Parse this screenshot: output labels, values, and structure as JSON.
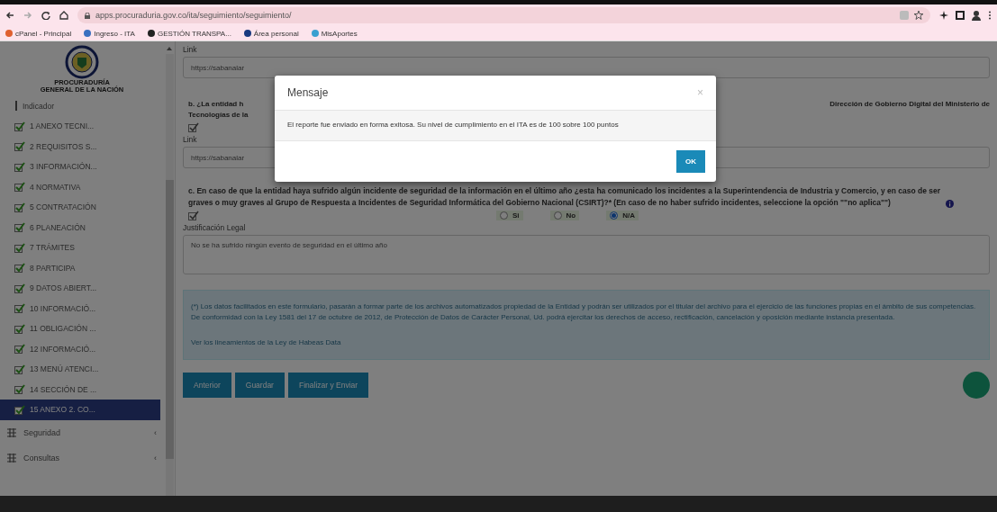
{
  "browser": {
    "url": "apps.procuraduria.gov.co/ita/seguimiento/seguimiento/",
    "bookmarks": [
      "cPanel - Principal",
      "Ingreso - ITA",
      "GESTIÓN TRANSPA...",
      "Área personal",
      "MisAportes"
    ]
  },
  "sidebar": {
    "logo_text": "PROCURADURÍA GENERAL DE LA NACIÓN",
    "items": [
      {
        "kind": "plain",
        "label": "Indicador",
        "selected": false
      },
      {
        "kind": "check",
        "label": "1 ANEXO TECNI...",
        "checked": true,
        "selected": false
      },
      {
        "kind": "check",
        "label": "2 REQUISITOS S...",
        "checked": true,
        "selected": false
      },
      {
        "kind": "check",
        "label": "3 INFORMACIÓN...",
        "checked": true,
        "selected": false
      },
      {
        "kind": "check",
        "label": "4 NORMATIVA",
        "checked": true,
        "selected": false
      },
      {
        "kind": "check",
        "label": "5 CONTRATACIÓN",
        "checked": true,
        "selected": false
      },
      {
        "kind": "check",
        "label": "6 PLANEACIÓN",
        "checked": true,
        "selected": false
      },
      {
        "kind": "check",
        "label": "7 TRÁMITES",
        "checked": true,
        "selected": false
      },
      {
        "kind": "check",
        "label": "8 PARTICIPA",
        "checked": true,
        "selected": false
      },
      {
        "kind": "check",
        "label": "9 DATOS ABIERT...",
        "checked": true,
        "selected": false
      },
      {
        "kind": "check",
        "label": "10 INFORMACIÓ...",
        "checked": true,
        "selected": false
      },
      {
        "kind": "check",
        "label": "11 OBLIGACIÓN ...",
        "checked": true,
        "selected": false
      },
      {
        "kind": "check",
        "label": "12 INFORMACIÓ...",
        "checked": true,
        "selected": false
      },
      {
        "kind": "check",
        "label": "13 MENÚ ATENCI...",
        "checked": true,
        "selected": false
      },
      {
        "kind": "check",
        "label": "14 SECCIÓN DE ...",
        "checked": true,
        "selected": false
      },
      {
        "kind": "check",
        "label": "15 ANEXO 2. CO...",
        "checked": true,
        "selected": true
      }
    ],
    "menus": [
      {
        "label": "Seguridad",
        "caret": "‹"
      },
      {
        "label": "Consultas",
        "caret": "‹"
      }
    ]
  },
  "form": {
    "link_1": {
      "label": "Link",
      "value": "https://sabanalar"
    },
    "question_b": {
      "start": "b. ¿La entidad h",
      "end": "Dirección de Gobierno Digital del Ministerio de",
      "line_2": "Tecnologías de la",
      "checked": true
    },
    "link_2": {
      "label": "Link",
      "value": "https://sabanalar"
    },
    "question_c": {
      "text": "c. En caso de que la entidad haya sufrido algún incidente de seguridad de la información en el último año ¿esta ha comunicado los incidentes a la Superintendencia de Industria y Comercio, y en caso de ser graves o muy graves al Grupo de Respuesta a Incidentes de Seguridad Informática del Gobierno Nacional (CSIRT)?* (En caso de no haber sufrido incidentes, seleccione la opción \"\"no aplica\"\")",
      "checked": true,
      "options": [
        {
          "label": "Si",
          "selected": false
        },
        {
          "label": "No",
          "selected": false
        },
        {
          "label": "N/A",
          "selected": true
        }
      ]
    },
    "justification": {
      "label": "Justificación Legal",
      "value": "No se ha sufrido ningún evento de seguridad en el último año"
    },
    "notice": {
      "text": "(*) Los datos facilitados en este formulario, pasarán a formar parte de los archivos automatizados propiedad de la Entidad y podrán ser utilizados por el titular del archivo para el ejercicio de las funciones propias en el ámbito de sus competencias. De conformidad con la Ley 1581 del 17 de octubre de 2012, de Protección de Datos de Carácter Personal, Ud. podrá ejercitar los derechos de acceso, rectificación, cancelación y oposición mediante instancia presentada.",
      "link": "Ver los lineamientos de la Ley de Habeas Data"
    },
    "buttons": [
      "Anterior",
      "Guardar",
      "Finalizar y Enviar"
    ]
  },
  "modal": {
    "title": "Mensaje",
    "close": "×",
    "message": "El reporte fue enviado en forma exitosa. Su nivel de cumplimiento en el ITA es de 100 sobre 100 puntos",
    "button": "OK"
  }
}
